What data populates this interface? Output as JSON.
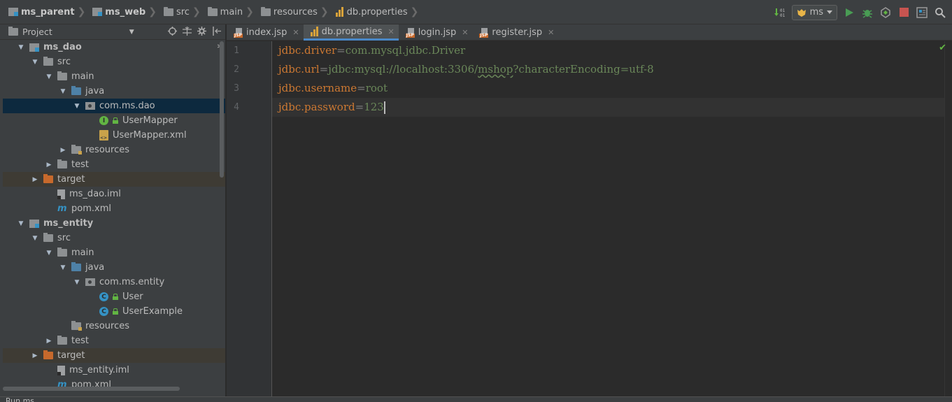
{
  "breadcrumbs": [
    {
      "label": "ms_parent",
      "icon": "module-icon",
      "bold": true
    },
    {
      "label": "ms_web",
      "icon": "module-icon",
      "bold": true
    },
    {
      "label": "src",
      "icon": "folder-icon",
      "bold": false
    },
    {
      "label": "main",
      "icon": "folder-icon",
      "bold": false
    },
    {
      "label": "resources",
      "icon": "resources-folder-icon",
      "bold": false
    },
    {
      "label": "db.properties",
      "icon": "properties-file-icon",
      "bold": false
    }
  ],
  "toolbar": {
    "run_config": "ms"
  },
  "project_panel": {
    "title": "Project"
  },
  "tree": [
    {
      "label": "ms_dao",
      "depth": 0,
      "arrow": "down",
      "icon": "module",
      "bold": true
    },
    {
      "label": "src",
      "depth": 1,
      "arrow": "down",
      "icon": "folder"
    },
    {
      "label": "main",
      "depth": 2,
      "arrow": "down",
      "icon": "folder"
    },
    {
      "label": "java",
      "depth": 3,
      "arrow": "down",
      "icon": "folder-blue"
    },
    {
      "label": "com.ms.dao",
      "depth": 4,
      "arrow": "down",
      "icon": "package",
      "selected": true
    },
    {
      "label": "UserMapper",
      "depth": 5,
      "arrow": "none",
      "icon": "interface"
    },
    {
      "label": "UserMapper.xml",
      "depth": 5,
      "arrow": "none",
      "icon": "xml"
    },
    {
      "label": "resources",
      "depth": 3,
      "arrow": "right",
      "icon": "folder-res"
    },
    {
      "label": "test",
      "depth": 2,
      "arrow": "right",
      "icon": "folder"
    },
    {
      "label": "target",
      "depth": 1,
      "arrow": "right",
      "icon": "folder-orange",
      "highlight": true
    },
    {
      "label": "ms_dao.iml",
      "depth": 2,
      "arrow": "none",
      "icon": "iml"
    },
    {
      "label": "pom.xml",
      "depth": 2,
      "arrow": "none",
      "icon": "maven"
    },
    {
      "label": "ms_entity",
      "depth": 0,
      "arrow": "down",
      "icon": "module",
      "bold": true
    },
    {
      "label": "src",
      "depth": 1,
      "arrow": "down",
      "icon": "folder"
    },
    {
      "label": "main",
      "depth": 2,
      "arrow": "down",
      "icon": "folder"
    },
    {
      "label": "java",
      "depth": 3,
      "arrow": "down",
      "icon": "folder-blue"
    },
    {
      "label": "com.ms.entity",
      "depth": 4,
      "arrow": "down",
      "icon": "package"
    },
    {
      "label": "User",
      "depth": 5,
      "arrow": "none",
      "icon": "class"
    },
    {
      "label": "UserExample",
      "depth": 5,
      "arrow": "none",
      "icon": "class"
    },
    {
      "label": "resources",
      "depth": 3,
      "arrow": "none",
      "icon": "folder-res"
    },
    {
      "label": "test",
      "depth": 2,
      "arrow": "right",
      "icon": "folder"
    },
    {
      "label": "target",
      "depth": 1,
      "arrow": "right",
      "icon": "folder-orange",
      "highlight": true
    },
    {
      "label": "ms_entity.iml",
      "depth": 2,
      "arrow": "none",
      "icon": "iml"
    },
    {
      "label": "pom.xml",
      "depth": 2,
      "arrow": "none",
      "icon": "maven"
    }
  ],
  "tabs": [
    {
      "label": "index.jsp",
      "icon": "jsp-file-icon",
      "active": false
    },
    {
      "label": "db.properties",
      "icon": "properties-file-icon",
      "active": true
    },
    {
      "label": "login.jsp",
      "icon": "jsp-file-icon",
      "active": false
    },
    {
      "label": "register.jsp",
      "icon": "jsp-file-icon",
      "active": false
    }
  ],
  "editor": {
    "lines": [
      {
        "number": "1",
        "key": "jdbc.driver",
        "value": "com.mysql.jdbc.Driver"
      },
      {
        "number": "2",
        "key": "jdbc.url",
        "value_before": "jdbc:mysql://localhost:3306/",
        "value_typo": "mshop",
        "value_after": "?characterEncoding=utf-8"
      },
      {
        "number": "3",
        "key": "jdbc.username",
        "value": "root"
      },
      {
        "number": "4",
        "key": "jdbc.password",
        "value": "123",
        "current": true
      }
    ]
  },
  "bottom": {
    "run_label": "Run",
    "run_config": "ms"
  },
  "colors": {
    "keyword": "#cc7832",
    "string": "#6a8759",
    "selection": "#0d293e",
    "accent": "#4a88c7"
  }
}
